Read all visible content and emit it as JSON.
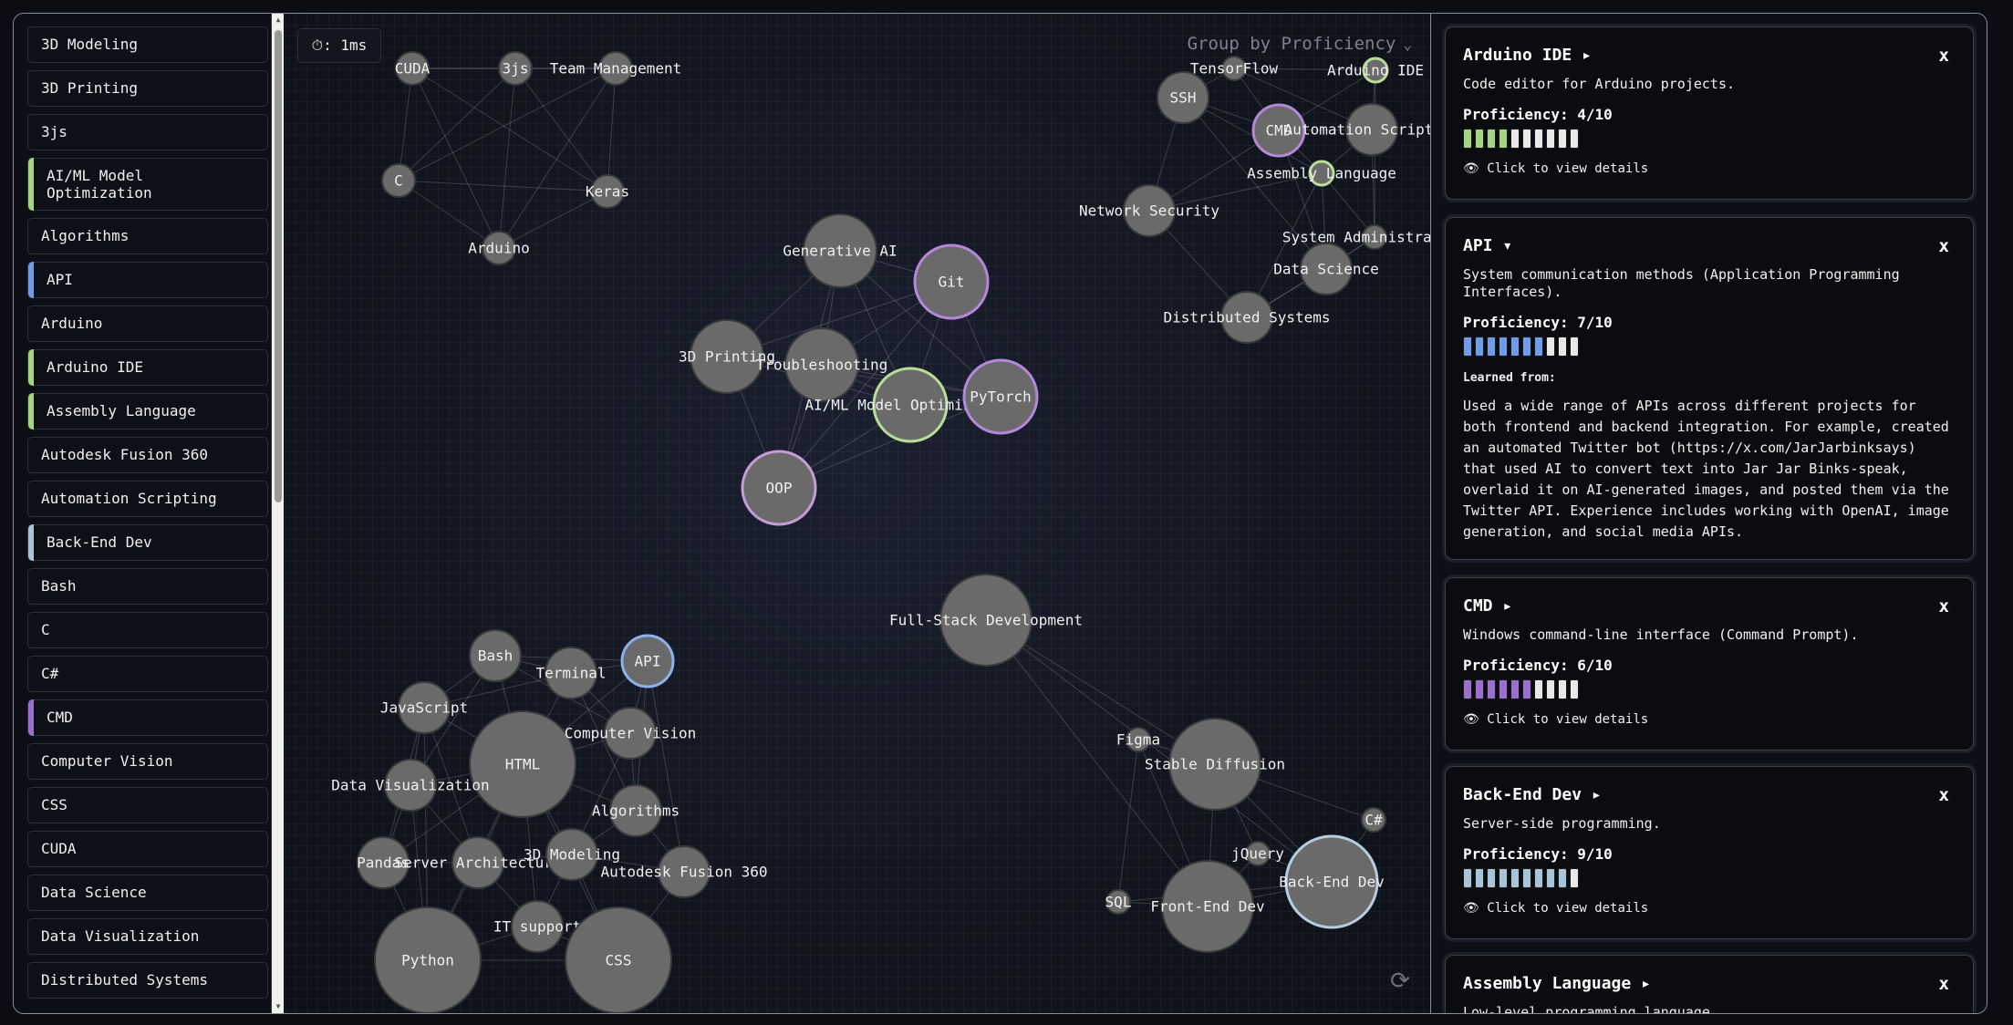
{
  "sidebar": {
    "items": [
      {
        "label": "3D Modeling",
        "accent": ""
      },
      {
        "label": "3D Printing",
        "accent": ""
      },
      {
        "label": "3js",
        "accent": ""
      },
      {
        "label": "AI/ML Model Optimization",
        "accent": "#a5d483"
      },
      {
        "label": "Algorithms",
        "accent": ""
      },
      {
        "label": "API",
        "accent": "#6f9be8"
      },
      {
        "label": "Arduino",
        "accent": ""
      },
      {
        "label": "Arduino IDE",
        "accent": "#a5d483"
      },
      {
        "label": "Assembly Language",
        "accent": "#a5d483"
      },
      {
        "label": "Autodesk Fusion 360",
        "accent": ""
      },
      {
        "label": "Automation Scripting",
        "accent": ""
      },
      {
        "label": "Back-End Dev",
        "accent": "#a9c4d8"
      },
      {
        "label": "Bash",
        "accent": ""
      },
      {
        "label": "C",
        "accent": ""
      },
      {
        "label": "C#",
        "accent": ""
      },
      {
        "label": "CMD",
        "accent": "#9b6fcf"
      },
      {
        "label": "Computer Vision",
        "accent": ""
      },
      {
        "label": "CSS",
        "accent": ""
      },
      {
        "label": "CUDA",
        "accent": ""
      },
      {
        "label": "Data Science",
        "accent": ""
      },
      {
        "label": "Data Visualization",
        "accent": ""
      },
      {
        "label": "Distributed Systems",
        "accent": ""
      }
    ]
  },
  "graph": {
    "timer": "⏱: 1ms",
    "group_by": "Group by Proficiency",
    "chevron_icon": "chevron-down-icon",
    "refresh_icon": "refresh-icon",
    "nodes": [
      {
        "id": "CUDA",
        "label": "CUDA",
        "size": "s"
      },
      {
        "id": "3js",
        "label": "3js",
        "size": "s"
      },
      {
        "id": "Team Management",
        "label": "Team Management",
        "size": "s"
      },
      {
        "id": "C",
        "label": "C",
        "size": "s"
      },
      {
        "id": "Keras",
        "label": "Keras",
        "size": "s"
      },
      {
        "id": "Arduino",
        "label": "Arduino",
        "size": "s"
      },
      {
        "id": "Generative AI",
        "label": "Generative AI",
        "size": "l"
      },
      {
        "id": "Git",
        "label": "Git",
        "size": "l",
        "ring": "#b487d9"
      },
      {
        "id": "3D Printing",
        "label": "3D Printing",
        "size": "l"
      },
      {
        "id": "Troubleshooting",
        "label": "Troubleshooting",
        "size": "l"
      },
      {
        "id": "AI/ML Model Optimization",
        "label": "AI/ML Model Optimization",
        "size": "l",
        "ring": "#b9dd98"
      },
      {
        "id": "PyTorch",
        "label": "PyTorch",
        "size": "l",
        "ring": "#b487d9"
      },
      {
        "id": "OOP",
        "label": "OOP",
        "size": "l",
        "ring": "#c79bd6"
      },
      {
        "id": "Full-Stack Development",
        "label": "Full-Stack Development",
        "size": "xl"
      },
      {
        "id": "SSH",
        "label": "SSH",
        "size": "m"
      },
      {
        "id": "TensorFlow",
        "label": "TensorFlow",
        "size": "xs"
      },
      {
        "id": "Arduino IDE",
        "label": "Arduino IDE",
        "size": "xs",
        "ring": "#b9dd98"
      },
      {
        "id": "CMD",
        "label": "CMD",
        "size": "m",
        "ring": "#b487d9"
      },
      {
        "id": "Automation Scripting",
        "label": "Automation Scripting",
        "size": "m"
      },
      {
        "id": "Assembly Language",
        "label": "Assembly Language",
        "size": "xs",
        "ring": "#b9dd98"
      },
      {
        "id": "Network Security",
        "label": "Network Security",
        "size": "m"
      },
      {
        "id": "System Administration",
        "label": "System Administration",
        "size": "xs"
      },
      {
        "id": "Data Science",
        "label": "Data Science",
        "size": "m"
      },
      {
        "id": "Distributed Systems",
        "label": "Distributed Systems",
        "size": "m"
      },
      {
        "id": "Bash",
        "label": "Bash",
        "size": "m"
      },
      {
        "id": "Terminal",
        "label": "Terminal",
        "size": "m"
      },
      {
        "id": "API",
        "label": "API",
        "size": "m",
        "ring": "#8fb0e8"
      },
      {
        "id": "JavaScript",
        "label": "JavaScript",
        "size": "m"
      },
      {
        "id": "HTML",
        "label": "HTML",
        "size": "xxl"
      },
      {
        "id": "Computer Vision",
        "label": "Computer Vision",
        "size": "m"
      },
      {
        "id": "Data Visualization",
        "label": "Data Visualization",
        "size": "m"
      },
      {
        "id": "Algorithms",
        "label": "Algorithms",
        "size": "m"
      },
      {
        "id": "Pandas",
        "label": "Pandas",
        "size": "m"
      },
      {
        "id": "Server Architecture",
        "label": "Server Architecture",
        "size": "m"
      },
      {
        "id": "3D Modeling",
        "label": "3D Modeling",
        "size": "m"
      },
      {
        "id": "Autodesk Fusion 360",
        "label": "Autodesk Fusion 360",
        "size": "m"
      },
      {
        "id": "IT support",
        "label": "IT support",
        "size": "m"
      },
      {
        "id": "Python",
        "label": "Python",
        "size": "xxl"
      },
      {
        "id": "CSS",
        "label": "CSS",
        "size": "xxl"
      },
      {
        "id": "Figma",
        "label": "Figma",
        "size": "xs"
      },
      {
        "id": "Stable Diffusion",
        "label": "Stable Diffusion",
        "size": "xl"
      },
      {
        "id": "C#",
        "label": "C#",
        "size": "xs"
      },
      {
        "id": "jQuery",
        "label": "jQuery",
        "size": "xs"
      },
      {
        "id": "Back-End Dev",
        "label": "Back-End Dev",
        "size": "xl",
        "ring": "#b6cde0"
      },
      {
        "id": "SQL",
        "label": "SQL",
        "size": "xs"
      },
      {
        "id": "Front-End Dev",
        "label": "Front-End Dev",
        "size": "xl"
      }
    ],
    "edges": [
      [
        "CUDA",
        "3js"
      ],
      [
        "3js",
        "Team Management"
      ],
      [
        "CUDA",
        "C"
      ],
      [
        "CUDA",
        "Keras"
      ],
      [
        "CUDA",
        "Arduino"
      ],
      [
        "3js",
        "C"
      ],
      [
        "3js",
        "Keras"
      ],
      [
        "3js",
        "Arduino"
      ],
      [
        "Team Management",
        "C"
      ],
      [
        "Team Management",
        "Keras"
      ],
      [
        "Team Management",
        "Arduino"
      ],
      [
        "C",
        "Keras"
      ],
      [
        "C",
        "Arduino"
      ],
      [
        "Keras",
        "Arduino"
      ],
      [
        "CUDA",
        "Team Management"
      ],
      [
        "Generative AI",
        "Git"
      ],
      [
        "Generative AI",
        "3D Printing"
      ],
      [
        "Generative AI",
        "Troubleshooting"
      ],
      [
        "Generative AI",
        "AI/ML Model Optimization"
      ],
      [
        "Generative AI",
        "PyTorch"
      ],
      [
        "Generative AI",
        "OOP"
      ],
      [
        "Git",
        "3D Printing"
      ],
      [
        "Git",
        "Troubleshooting"
      ],
      [
        "Git",
        "AI/ML Model Optimization"
      ],
      [
        "Git",
        "PyTorch"
      ],
      [
        "Git",
        "OOP"
      ],
      [
        "3D Printing",
        "Troubleshooting"
      ],
      [
        "3D Printing",
        "AI/ML Model Optimization"
      ],
      [
        "3D Printing",
        "OOP"
      ],
      [
        "3D Printing",
        "PyTorch"
      ],
      [
        "Troubleshooting",
        "AI/ML Model Optimization"
      ],
      [
        "Troubleshooting",
        "PyTorch"
      ],
      [
        "Troubleshooting",
        "OOP"
      ],
      [
        "AI/ML Model Optimization",
        "PyTorch"
      ],
      [
        "AI/ML Model Optimization",
        "OOP"
      ],
      [
        "PyTorch",
        "OOP"
      ],
      [
        "SSH",
        "TensorFlow"
      ],
      [
        "TensorFlow",
        "Arduino IDE"
      ],
      [
        "SSH",
        "CMD"
      ],
      [
        "SSH",
        "Network Security"
      ],
      [
        "SSH",
        "Assembly Language"
      ],
      [
        "SSH",
        "Data Science"
      ],
      [
        "TensorFlow",
        "CMD"
      ],
      [
        "TensorFlow",
        "Automation Scripting"
      ],
      [
        "Arduino IDE",
        "CMD"
      ],
      [
        "Arduino IDE",
        "Automation Scripting"
      ],
      [
        "Arduino IDE",
        "System Administration"
      ],
      [
        "CMD",
        "Automation Scripting"
      ],
      [
        "CMD",
        "Assembly Language"
      ],
      [
        "CMD",
        "Network Security"
      ],
      [
        "CMD",
        "Data Science"
      ],
      [
        "Automation Scripting",
        "Assembly Language"
      ],
      [
        "Automation Scripting",
        "System Administration"
      ],
      [
        "Assembly Language",
        "Network Security"
      ],
      [
        "Assembly Language",
        "System Administration"
      ],
      [
        "Assembly Language",
        "Data Science"
      ],
      [
        "Assembly Language",
        "Distributed Systems"
      ],
      [
        "Network Security",
        "Distributed Systems"
      ],
      [
        "System Administration",
        "Data Science"
      ],
      [
        "Data Science",
        "Distributed Systems"
      ],
      [
        "System Administration",
        "Distributed Systems"
      ],
      [
        "Bash",
        "Terminal"
      ],
      [
        "Bash",
        "API"
      ],
      [
        "Bash",
        "JavaScript"
      ],
      [
        "Bash",
        "HTML"
      ],
      [
        "Bash",
        "Computer Vision"
      ],
      [
        "Bash",
        "Data Visualization"
      ],
      [
        "Terminal",
        "API"
      ],
      [
        "Terminal",
        "HTML"
      ],
      [
        "Terminal",
        "JavaScript"
      ],
      [
        "Terminal",
        "Computer Vision"
      ],
      [
        "Terminal",
        "Algorithms"
      ],
      [
        "API",
        "Computer Vision"
      ],
      [
        "API",
        "HTML"
      ],
      [
        "API",
        "Algorithms"
      ],
      [
        "API",
        "Autodesk Fusion 360"
      ],
      [
        "JavaScript",
        "HTML"
      ],
      [
        "JavaScript",
        "Data Visualization"
      ],
      [
        "JavaScript",
        "Pandas"
      ],
      [
        "JavaScript",
        "Server Architecture"
      ],
      [
        "JavaScript",
        "Python"
      ],
      [
        "HTML",
        "Computer Vision"
      ],
      [
        "HTML",
        "Data Visualization"
      ],
      [
        "HTML",
        "Algorithms"
      ],
      [
        "HTML",
        "Pandas"
      ],
      [
        "HTML",
        "Server Architecture"
      ],
      [
        "HTML",
        "3D Modeling"
      ],
      [
        "HTML",
        "IT support"
      ],
      [
        "HTML",
        "Python"
      ],
      [
        "HTML",
        "CSS"
      ],
      [
        "Computer Vision",
        "Algorithms"
      ],
      [
        "Computer Vision",
        "3D Modeling"
      ],
      [
        "Data Visualization",
        "Pandas"
      ],
      [
        "Data Visualization",
        "Server Architecture"
      ],
      [
        "Data Visualization",
        "Python"
      ],
      [
        "Algorithms",
        "3D Modeling"
      ],
      [
        "Algorithms",
        "Autodesk Fusion 360"
      ],
      [
        "Pandas",
        "Server Architecture"
      ],
      [
        "Pandas",
        "Python"
      ],
      [
        "Server Architecture",
        "3D Modeling"
      ],
      [
        "Server Architecture",
        "IT support"
      ],
      [
        "Server Architecture",
        "Python"
      ],
      [
        "3D Modeling",
        "Autodesk Fusion 360"
      ],
      [
        "3D Modeling",
        "IT support"
      ],
      [
        "3D Modeling",
        "CSS"
      ],
      [
        "Autodesk Fusion 360",
        "CSS"
      ],
      [
        "IT support",
        "Python"
      ],
      [
        "IT support",
        "CSS"
      ],
      [
        "Python",
        "CSS"
      ],
      [
        "Full-Stack Development",
        "Stable Diffusion"
      ],
      [
        "Full-Stack Development",
        "Back-End Dev"
      ],
      [
        "Full-Stack Development",
        "Front-End Dev"
      ],
      [
        "Figma",
        "Stable Diffusion"
      ],
      [
        "Figma",
        "SQL"
      ],
      [
        "Figma",
        "Front-End Dev"
      ],
      [
        "Stable Diffusion",
        "Back-End Dev"
      ],
      [
        "Stable Diffusion",
        "Front-End Dev"
      ],
      [
        "Stable Diffusion",
        "jQuery"
      ],
      [
        "Stable Diffusion",
        "C#"
      ],
      [
        "C#",
        "Back-End Dev"
      ],
      [
        "jQuery",
        "Back-End Dev"
      ],
      [
        "jQuery",
        "Front-End Dev"
      ],
      [
        "SQL",
        "Front-End Dev"
      ],
      [
        "Back-End Dev",
        "Front-End Dev"
      ],
      [
        "SQL",
        "Back-End Dev"
      ]
    ]
  },
  "panel": {
    "cards": [
      {
        "title": "Arduino IDE",
        "toggle": "▸",
        "close": "x",
        "description": "Code editor for Arduino projects.",
        "proficiency_label": "Proficiency: 4/10",
        "proficiency": 4,
        "color": "#a5d483",
        "link": "👁 Click to view details"
      },
      {
        "title": "API",
        "toggle": "▾",
        "close": "x",
        "description": "System communication methods (Application Programming Interfaces).",
        "proficiency_label": "Proficiency: 7/10",
        "proficiency": 7,
        "color": "#6f9be8",
        "learned_title": "Learned from:",
        "learned_text": "Used a wide range of APIs across different projects for both frontend and backend integration. For example, created an automated Twitter bot (https://x.com/JarJarbinksays) that used AI to convert text into Jar Jar Binks-speak, overlaid it on AI-generated images, and posted them via the Twitter API. Experience includes working with OpenAI, image generation, and social media APIs."
      },
      {
        "title": "CMD",
        "toggle": "▸",
        "close": "x",
        "description": "Windows command-line interface (Command Prompt).",
        "proficiency_label": "Proficiency: 6/10",
        "proficiency": 6,
        "color": "#9b6fcf",
        "link": "👁 Click to view details"
      },
      {
        "title": "Back-End Dev",
        "toggle": "▸",
        "close": "x",
        "description": "Server-side programming.",
        "proficiency_label": "Proficiency: 9/10",
        "proficiency": 9,
        "color": "#a9c4d8",
        "link": "👁 Click to view details"
      },
      {
        "title": "Assembly Language",
        "toggle": "▸",
        "close": "x",
        "description": "Low-level programming language."
      }
    ]
  }
}
